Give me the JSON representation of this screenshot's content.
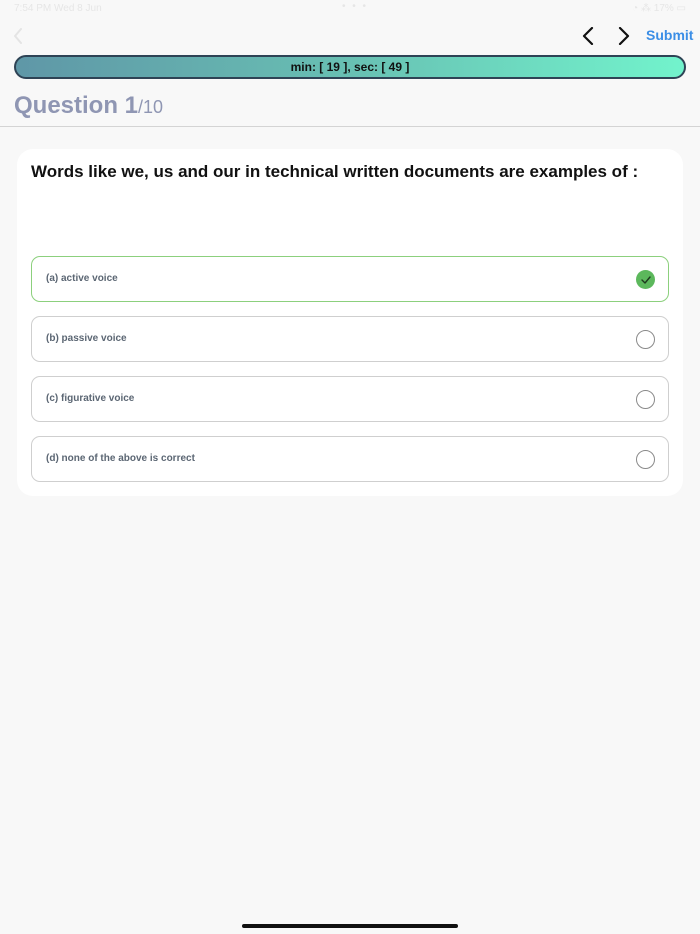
{
  "status_bar": {
    "time": "7:54 PM  Wed 8 Jun",
    "center": "• • •",
    "right": "◔  ⁂  17%  ▭"
  },
  "nav": {
    "submit_label": "Submit"
  },
  "timer": {
    "text": "min: [ 19 ], sec: [ 49 ]"
  },
  "question": {
    "number": "Question 1",
    "total": "/10",
    "text": "Words like we, us and our in technical written documents are examples of :"
  },
  "options": [
    {
      "label": "(a) active voice",
      "selected": true
    },
    {
      "label": "(b) passive voice",
      "selected": false
    },
    {
      "label": "(c) figurative voice",
      "selected": false
    },
    {
      "label": "(d) none of the above is correct",
      "selected": false
    }
  ],
  "colors": {
    "accent": "#3b8ee6",
    "selected_border": "#8cd07d",
    "selected_check": "#5cb85c",
    "header_text": "#8f96b3"
  }
}
